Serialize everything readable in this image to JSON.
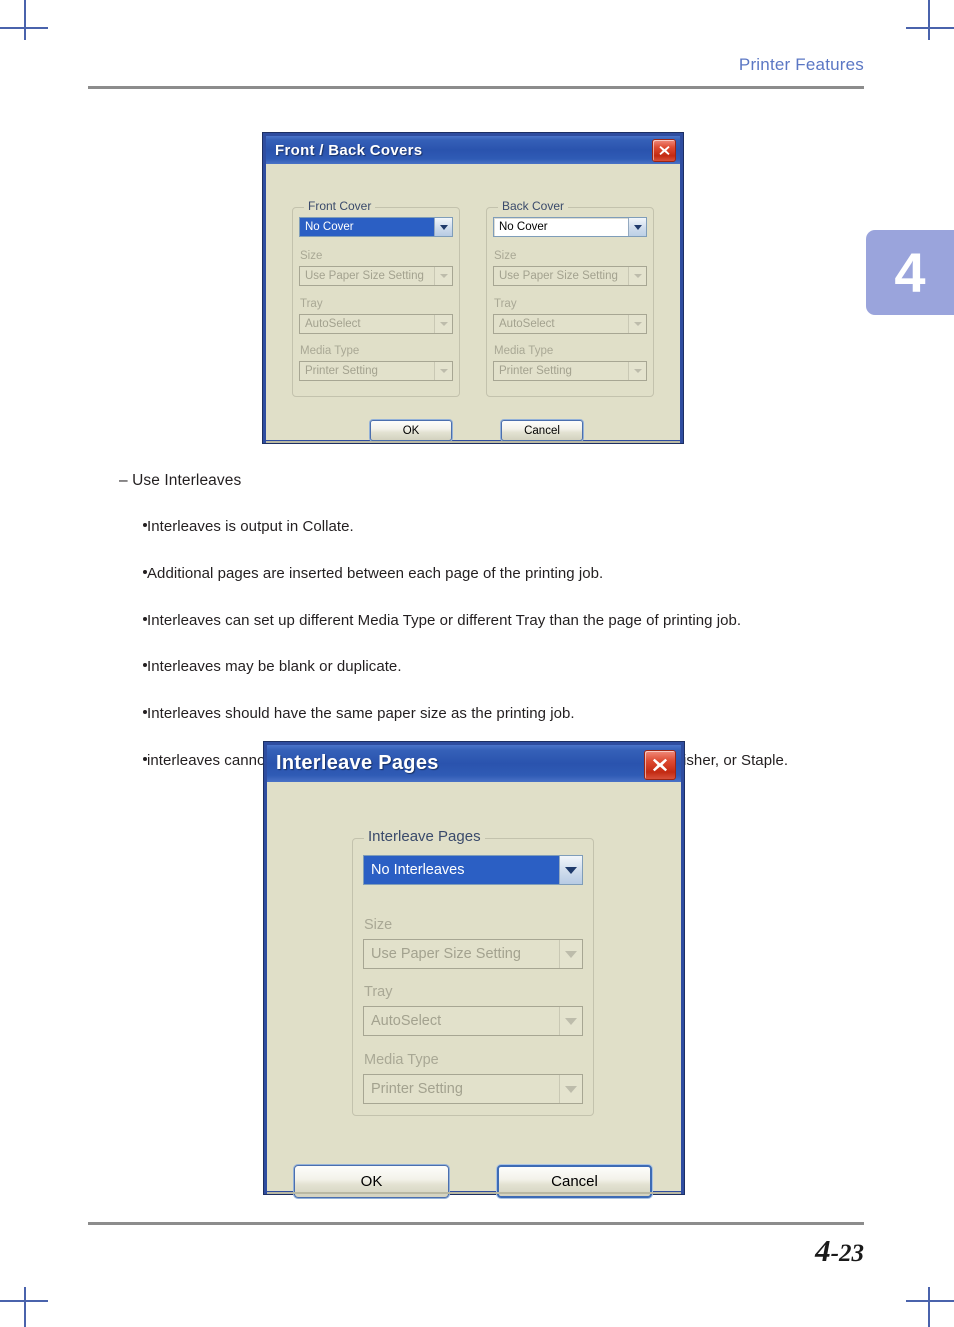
{
  "page": {
    "header_title": "Printer Features",
    "chapter_tab": "4",
    "footer": {
      "chapter": "4",
      "separator": "-",
      "number": "23"
    }
  },
  "body_copy": {
    "section_heading": "– Use Interleaves",
    "bullets": [
      "Interleaves  is output in Collate.",
      "Additional pages are inserted between each page of the printing job.",
      "Interleaves can set up different Media Type or different Tray than the page of printing job.",
      "Interleaves may be blank or duplicate.",
      "Interleaves should have the same paper size as the printing job.",
      " interleaves  cannot be used together with Rotation Sort, Duplex, Poster Print, Finisher, or Staple."
    ]
  },
  "dialog_covers": {
    "title": "Front / Back Covers",
    "close_icon": "close-icon",
    "front_group": {
      "label": "Front Cover",
      "cover_value": "No Cover",
      "size_label": "Size",
      "size_value": "Use Paper Size Setting",
      "tray_label": "Tray",
      "tray_value": "AutoSelect",
      "media_label": "Media Type",
      "media_value": "Printer Setting"
    },
    "back_group": {
      "label": "Back Cover",
      "cover_value": "No Cover",
      "size_label": "Size",
      "size_value": "Use Paper Size Setting",
      "tray_label": "Tray",
      "tray_value": "AutoSelect",
      "media_label": "Media Type",
      "media_value": "Printer Setting"
    },
    "ok_label": "OK",
    "cancel_label": "Cancel"
  },
  "dialog_interleave": {
    "title": "Interleave Pages",
    "close_icon": "close-icon",
    "group": {
      "label": "Interleave Pages",
      "interleave_value": "No Interleaves",
      "size_label": "Size",
      "size_value": "Use Paper Size Setting",
      "tray_label": "Tray",
      "tray_value": "AutoSelect",
      "media_label": "Media Type",
      "media_value": "Printer Setting"
    },
    "ok_label": "OK",
    "cancel_label": "Cancel"
  },
  "colors": {
    "header_blue": "#5b77c4",
    "rule_gray": "#8c8c8c",
    "chapter_tab_bg": "#9aa4dc",
    "crop_mark": "#4a63ac",
    "dialog_face": "#e0dfc8",
    "titlebar_blue": "#2a53ae",
    "close_red": "#c32a12",
    "select_blue": "#2b5fc4"
  }
}
